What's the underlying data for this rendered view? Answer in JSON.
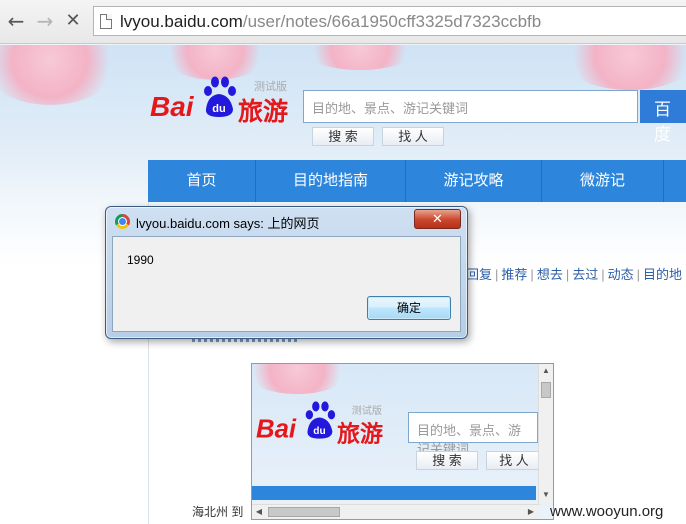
{
  "browser": {
    "url_host": "lvyou.baidu.com",
    "url_path": "/user/notes/66a1950cff3325d7323ccbfb",
    "icons": {
      "back": "back-arrow-icon",
      "forward": "forward-arrow-icon",
      "stop": "stop-x-icon",
      "page": "page-icon"
    }
  },
  "site": {
    "logo_bai": "Bai",
    "logo_du": "du",
    "logo_lv": "旅游",
    "logo_beta": "测试版",
    "search_placeholder": "目的地、景点、游记关键词",
    "search_button": "百度",
    "search_sub_button": "搜 索",
    "find_people_button": "找 人",
    "nav_items": [
      "首页",
      "目的地指南",
      "游记攻略",
      "微游记"
    ],
    "subnav_items": [
      "回复",
      "推荐",
      "想去",
      "去过",
      "动态",
      "目的地"
    ],
    "bottom_text": "海北州 到",
    "brand_color": "#e5171b",
    "nav_color": "#2d86db"
  },
  "iframe": {
    "logo_bai": "Bai",
    "logo_du": "du",
    "logo_lv": "旅游",
    "logo_beta": "测试版",
    "search_placeholder": "目的地、景点、游记关键词",
    "search_sub_button": "搜 索",
    "find_people_button": "找 人"
  },
  "dialog": {
    "title": "lvyou.baidu.com says: 上的网页",
    "message": "1990",
    "ok_button": "确定",
    "close_glyph": "✕"
  },
  "watermark": "www.wooyun.org"
}
